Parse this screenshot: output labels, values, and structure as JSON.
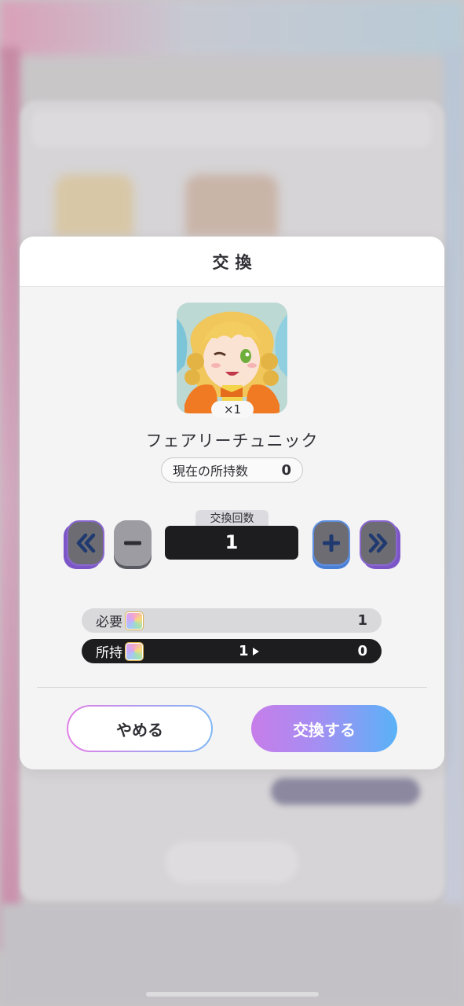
{
  "modal": {
    "title": "交換",
    "item": {
      "name": "フェアリーチュニック",
      "quantity": "×1",
      "owned_label": "現在の所持数",
      "owned_value": "0"
    },
    "exchange_count": {
      "label": "交換回数",
      "value": "1",
      "controls": {
        "min_icon": "double-chevron-left-icon",
        "minus_icon": "minus-icon",
        "plus_icon": "plus-icon",
        "max_icon": "double-chevron-right-icon"
      }
    },
    "requirement": {
      "need_label": "必要",
      "need_value": "1",
      "have_label": "所持",
      "have_value": "1",
      "have_after_value": "0"
    },
    "buttons": {
      "cancel_label": "やめる",
      "confirm_label": "交換する"
    }
  }
}
